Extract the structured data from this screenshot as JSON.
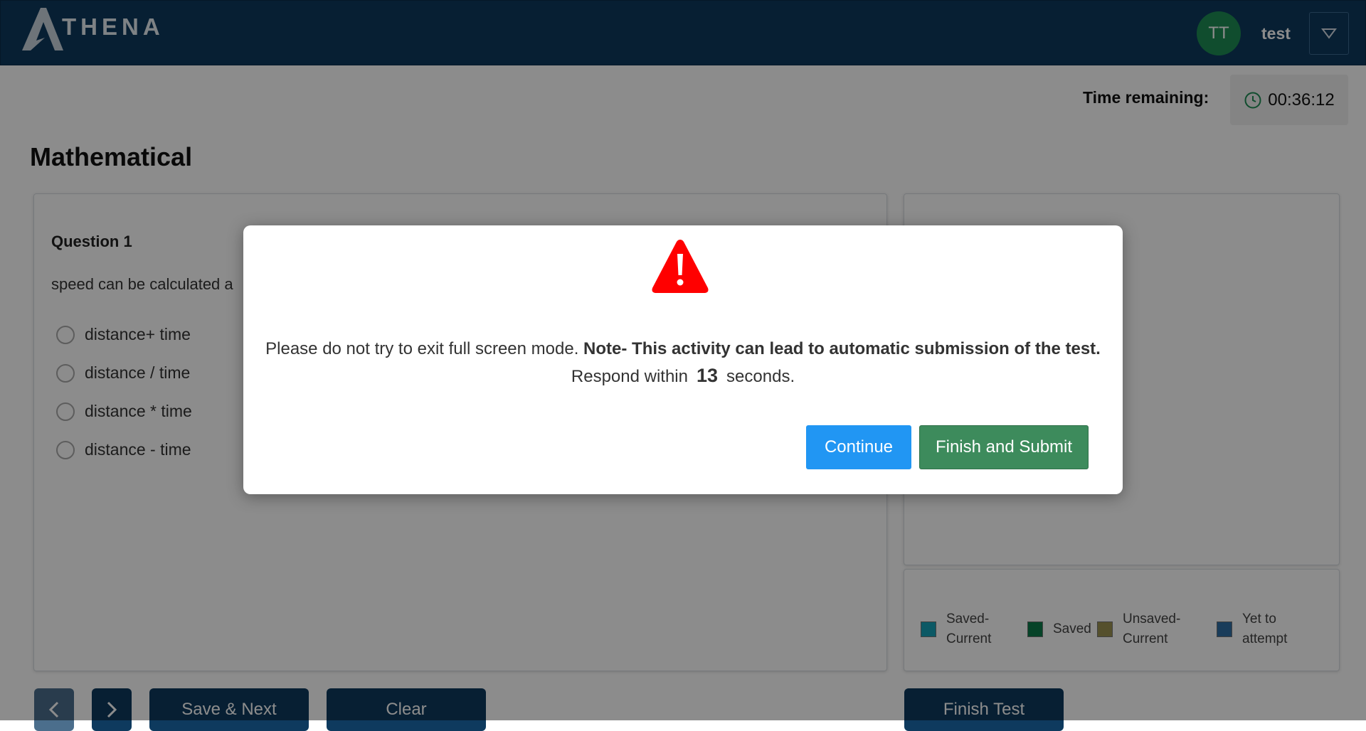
{
  "header": {
    "logo_text": "THENA",
    "avatar_initials": "TT",
    "username": "test"
  },
  "timer": {
    "label": "Time remaining:",
    "value": "00:36:12"
  },
  "section_title": "Mathematical",
  "question": {
    "title": "Question 1",
    "text": "speed can be calculated a",
    "options": [
      "distance+ time",
      "distance / time",
      "distance * time",
      "distance - time"
    ]
  },
  "legend": [
    {
      "label_line1": "Saved-",
      "label_line2": "Current",
      "color": "#17a2b8"
    },
    {
      "label_line1": "Saved",
      "label_line2": "",
      "color": "#0b7a4a"
    },
    {
      "label_line1": "Unsaved-",
      "label_line2": "Current",
      "color": "#9b9352"
    },
    {
      "label_line1": "Yet to",
      "label_line2": "attempt",
      "color": "#2e6da4"
    }
  ],
  "buttons": {
    "save_next": "Save & Next",
    "clear": "Clear",
    "finish_test": "Finish Test"
  },
  "modal": {
    "message": "Please do not try to exit full screen mode.",
    "note": "Note- This activity can lead to automatic submission of the test.",
    "respond_prefix": "Respond within",
    "countdown": "13",
    "respond_suffix": "seconds.",
    "continue_label": "Continue",
    "finish_submit_label": "Finish and Submit"
  },
  "colors": {
    "header_bg": "#0e3a5e",
    "continue_btn": "#2196f3",
    "finish_submit_btn": "#3d8b5c",
    "warning_red": "#ff0000"
  }
}
